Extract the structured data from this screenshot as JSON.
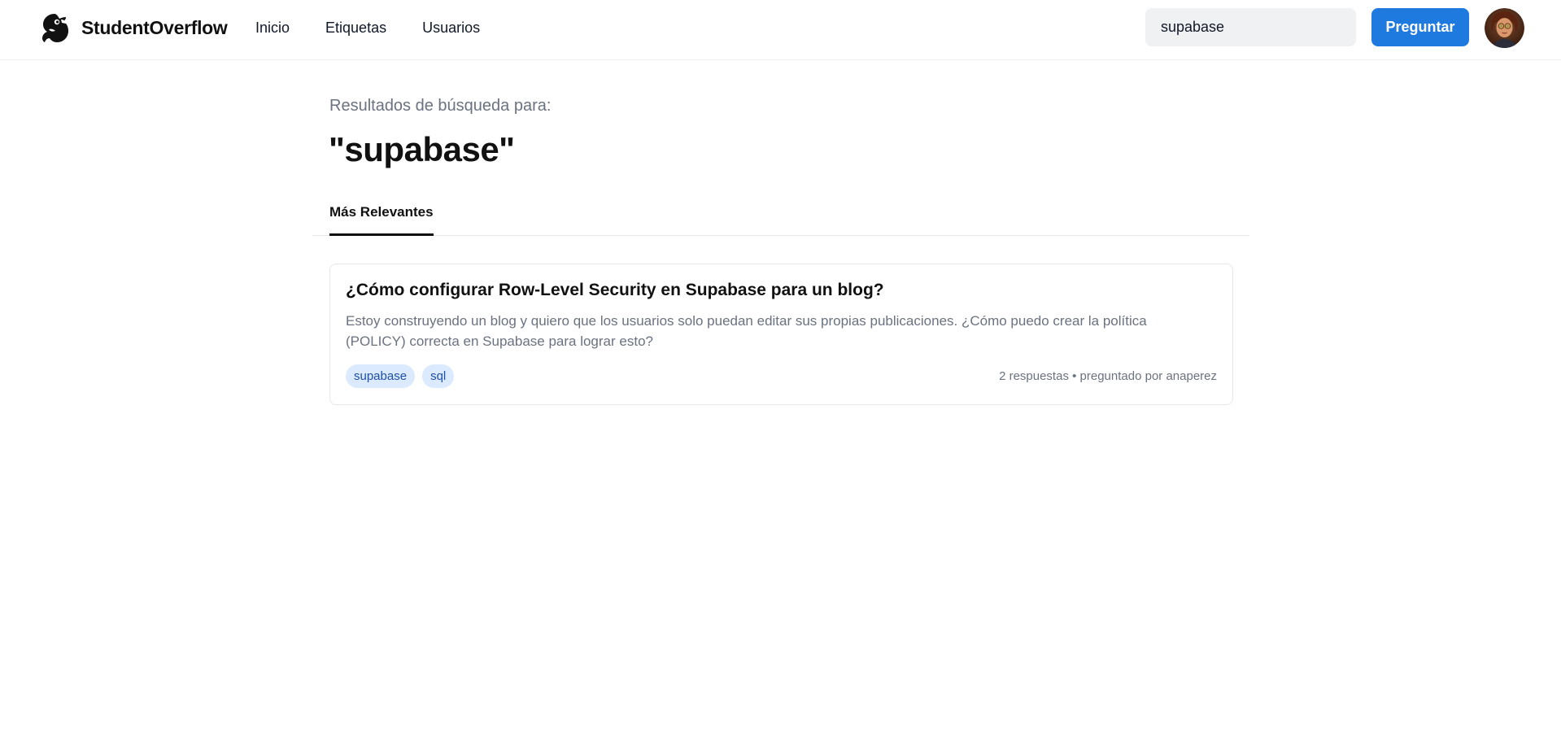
{
  "header": {
    "brand_name": "StudentOverflow",
    "logo_icon": "parrot-logo-icon",
    "nav": [
      {
        "label": "Inicio"
      },
      {
        "label": "Etiquetas"
      },
      {
        "label": "Usuarios"
      }
    ],
    "search": {
      "value": "supabase"
    },
    "ask_button_label": "Preguntar",
    "avatar_icon": "user-avatar"
  },
  "search_results": {
    "label": "Resultados de búsqueda para:",
    "query_display": "\"supabase\"",
    "tabs": [
      {
        "label": "Más Relevantes",
        "active": true
      }
    ],
    "questions": [
      {
        "title": "¿Cómo configurar Row-Level Security en Supabase para un blog?",
        "excerpt": "Estoy construyendo un blog y quiero que los usuarios solo puedan editar sus propias publicaciones. ¿Cómo puedo crear la política (POLICY) correcta en Supabase para lograr esto?",
        "tags": [
          "supabase",
          "sql"
        ],
        "meta": "2 respuestas • preguntado por anaperez"
      }
    ]
  },
  "colors": {
    "accent": "#1f7ae0",
    "tag_bg": "#dbeafe",
    "tag_text": "#1e4fa8",
    "muted_text": "#6b7280"
  }
}
